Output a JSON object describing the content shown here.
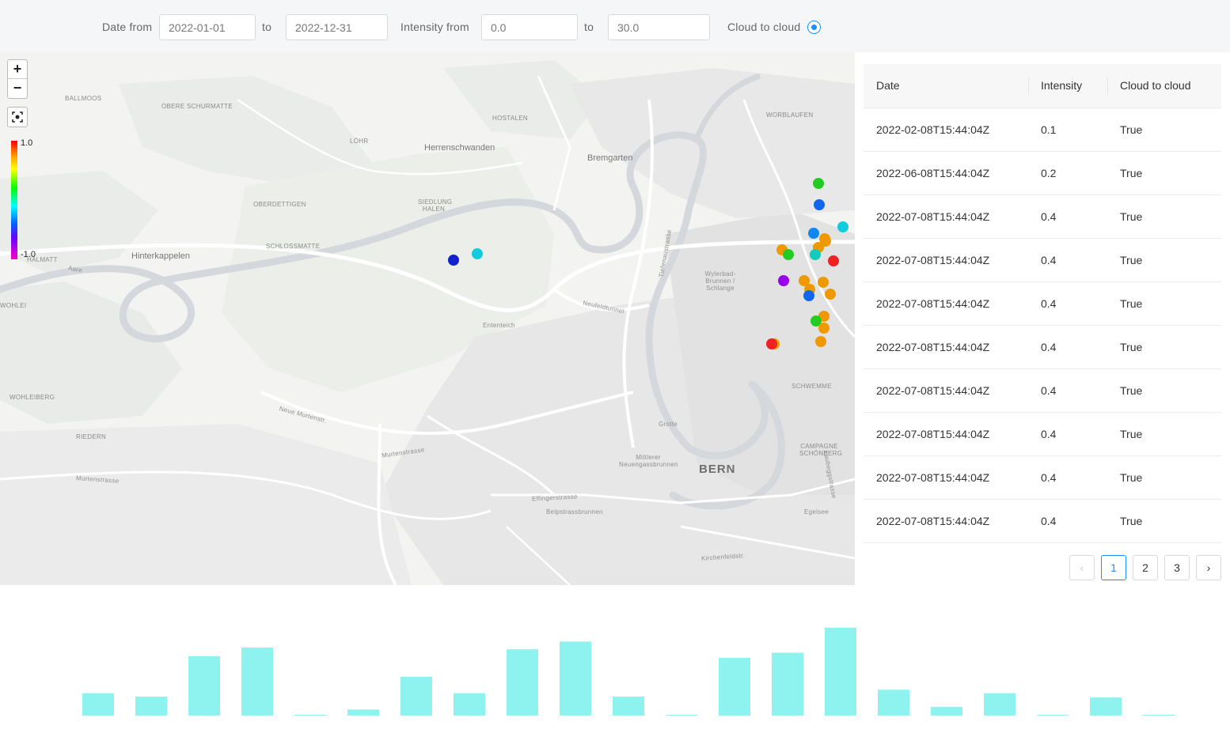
{
  "filters": {
    "date_from_label": "Date from",
    "date_to_label": "to",
    "date_from_value": "2022-01-01",
    "date_to_value": "2022-12-31",
    "intensity_from_label": "Intensity from",
    "intensity_to_label": "to",
    "intensity_from_value": "0.0",
    "intensity_to_value": "30.0",
    "cloud_label": "Cloud to cloud",
    "cloud_checked": true
  },
  "map": {
    "zoom_in": "+",
    "zoom_out": "−",
    "scale_max": "1.0",
    "scale_min": "-1.0",
    "places": {
      "bern": "BERN",
      "herrenschwanden": "Herrenschwanden",
      "bremgarten": "Bremgarten",
      "hinterkappelen": "Hinterkappelen",
      "ballmoos": "BALLMOOS",
      "obere_schurmatte": "OBERE SCHURMATTE",
      "hostalen": "HOSTALEN",
      "lohr": "LÖHR",
      "oberdettigen": "OBERDETTIGEN",
      "siedlung_halen": "SIEDLUNG HALEN",
      "schlossmatte": "SCHLOSSMATTE",
      "worblaufen": "WORBLAUFEN",
      "wohlei": "WOHLEI",
      "wohleiberg": "WOHLEIBERG",
      "riedern": "RIEDERN",
      "halmatt": "HALMATT",
      "campagne": "CAMPAGNE SCHÖNBERG",
      "schwemme": "SCHWEMME",
      "egelsee": "Egelsee",
      "grotte": "Grotte",
      "mittlerer": "Mittlerer Neuengassbrunnen",
      "wylerbad": "Wylerbad-Brunnen / Schlange",
      "ententeich": "Ententeich",
      "effingerstrasse": "Effingerstrasse",
      "belpstrasse": "Belpstrassbrunnen",
      "kirchenfeld": "Kirchenfeldstr.",
      "murtenstrasse": "Murtenstrasse",
      "neue_murtenstr": "Neue Murtenstr.",
      "neufeldtunnel": "Neufeldtunnel",
      "tiefenaustrasse": "Tiefenaustrasse",
      "laubeggstrasse": "Laubeggstrasse",
      "aare": "Aare"
    },
    "strikes": [
      {
        "lat": 46.962,
        "lon": 7.444,
        "color": "#22cc22"
      },
      {
        "lat": 46.9593,
        "lon": 7.4441,
        "color": "#1166ee"
      },
      {
        "lat": 46.9565,
        "lon": 7.4471,
        "color": "#11ccdd"
      },
      {
        "lat": 46.9557,
        "lon": 7.4434,
        "color": "#1188ee"
      },
      {
        "lat": 46.955,
        "lon": 7.4448,
        "color": "#ee9900"
      },
      {
        "lat": 46.9547,
        "lon": 7.4449,
        "color": "#ee9900"
      },
      {
        "lat": 46.9539,
        "lon": 7.444,
        "color": "#ee9900"
      },
      {
        "lat": 46.9536,
        "lon": 7.4394,
        "color": "#ee9900"
      },
      {
        "lat": 46.953,
        "lon": 7.4402,
        "color": "#22cc22"
      },
      {
        "lat": 46.953,
        "lon": 7.4436,
        "color": "#11ccbb"
      },
      {
        "lat": 46.9522,
        "lon": 7.4459,
        "color": "#ee2222"
      },
      {
        "lat": 46.9497,
        "lon": 7.4396,
        "color": "#9900ee"
      },
      {
        "lat": 46.9497,
        "lon": 7.4422,
        "color": "#ee9900"
      },
      {
        "lat": 46.9495,
        "lon": 7.4446,
        "color": "#ee9900"
      },
      {
        "lat": 46.9486,
        "lon": 7.4429,
        "color": "#ee9900"
      },
      {
        "lat": 46.9478,
        "lon": 7.4428,
        "color": "#1166ee"
      },
      {
        "lat": 46.948,
        "lon": 7.4455,
        "color": "#ee9900"
      },
      {
        "lat": 46.9452,
        "lon": 7.4447,
        "color": "#ee9900"
      },
      {
        "lat": 46.9446,
        "lon": 7.4437,
        "color": "#22cc22"
      },
      {
        "lat": 46.9437,
        "lon": 7.4447,
        "color": "#ee9900"
      },
      {
        "lat": 46.942,
        "lon": 7.4443,
        "color": "#ee9900"
      },
      {
        "lat": 46.9417,
        "lon": 7.4384,
        "color": "#ee9900"
      },
      {
        "lat": 46.9417,
        "lon": 7.4381,
        "color": "#ee2222"
      },
      {
        "lat": 46.9531,
        "lon": 7.4009,
        "color": "#11ccdd"
      },
      {
        "lat": 46.9523,
        "lon": 7.3979,
        "color": "#1122cc"
      }
    ]
  },
  "table": {
    "headers": [
      "Date",
      "Intensity",
      "Cloud to cloud"
    ],
    "rows": [
      [
        "2022-02-08T15:44:04Z",
        "0.1",
        "True"
      ],
      [
        "2022-06-08T15:44:04Z",
        "0.2",
        "True"
      ],
      [
        "2022-07-08T15:44:04Z",
        "0.4",
        "True"
      ],
      [
        "2022-07-08T15:44:04Z",
        "0.4",
        "True"
      ],
      [
        "2022-07-08T15:44:04Z",
        "0.4",
        "True"
      ],
      [
        "2022-07-08T15:44:04Z",
        "0.4",
        "True"
      ],
      [
        "2022-07-08T15:44:04Z",
        "0.4",
        "True"
      ],
      [
        "2022-07-08T15:44:04Z",
        "0.4",
        "True"
      ],
      [
        "2022-07-08T15:44:04Z",
        "0.4",
        "True"
      ],
      [
        "2022-07-08T15:44:04Z",
        "0.4",
        "True"
      ]
    ],
    "pagination": {
      "prev": "‹",
      "pages": [
        "1",
        "2",
        "3"
      ],
      "current": "1",
      "next": "›"
    }
  },
  "chart_data": {
    "type": "bar",
    "values": [
      2.6,
      2.2,
      6.9,
      7.9,
      0.1,
      0.7,
      4.5,
      2.6,
      7.7,
      8.6,
      2.2,
      0.05,
      6.7,
      7.3,
      10.2,
      3.0,
      1.0,
      2.6,
      0.1,
      2.1,
      0.05
    ],
    "color": "#8ef3ee",
    "grid": false
  },
  "theme": {
    "accent": "#1890ff"
  }
}
